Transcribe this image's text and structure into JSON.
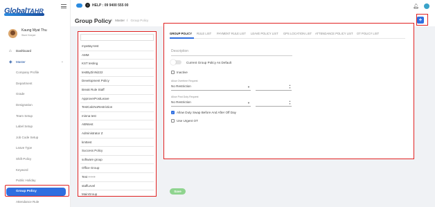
{
  "app": {
    "logo_main": "Global",
    "logo_sub": "TAHR",
    "help": "HELP : 09 9400 555 00"
  },
  "user": {
    "name": "Kaung Myat Thu",
    "role": "Store Keeper"
  },
  "sidebar": {
    "items": [
      {
        "label": "Dashboard"
      },
      {
        "label": "Master"
      },
      {
        "label": "Company Profile"
      },
      {
        "label": "Department"
      },
      {
        "label": "Grade"
      },
      {
        "label": "Designation"
      },
      {
        "label": "Team Setup"
      },
      {
        "label": "Label Setup"
      },
      {
        "label": "Job Code Setup"
      },
      {
        "label": "Leave Type"
      },
      {
        "label": "Shift Policy"
      },
      {
        "label": "Keyword"
      },
      {
        "label": "Public Holiday"
      },
      {
        "label": "Group Policy"
      },
      {
        "label": "Attendance Rule"
      }
    ]
  },
  "page": {
    "title": "Group Policy",
    "breadcrumb": [
      "Master",
      "Group Policy"
    ],
    "add_label": "+"
  },
  "list": {
    "search_placeholder": "",
    "items": [
      "myattay-test",
      "AMM",
      "KST testing",
      "testByZinNi222",
      "Development Policy",
      "Break Rule Staff",
      "ApproverPostLeave",
      "TestCalcNoRestriction",
      "minna test",
      "ABNtest",
      "Administrator Z",
      "kmttest",
      "Success Policy",
      "software group",
      "Office Group",
      "Test ++++",
      "staffLevel",
      "MainGroup"
    ]
  },
  "tabs": [
    {
      "label": "GROUP POLICY",
      "active": true
    },
    {
      "label": "RULE LIST",
      "active": false
    },
    {
      "label": "PAYMENT RULE LIST",
      "active": false
    },
    {
      "label": "LEAVE POLICY LIST",
      "active": false
    },
    {
      "label": "GPS LOCATION LIST",
      "active": false
    },
    {
      "label": "ATTENDANCE POLICY LIST",
      "active": false
    },
    {
      "label": "OT POLICY LIST",
      "active": false
    }
  ],
  "form": {
    "description_placeholder": "Description",
    "default_toggle_label": "Current Group Policy As Default",
    "inactive_label": "Inactive",
    "overtime_request_label": "Allow Overtime Request",
    "overtime_request_value": "No Restriction",
    "post_duty_request_label": "Allow Post Duty Request",
    "post_duty_request_value": "No Restriction",
    "duty_swap_label": "Allow Duty Swap Before And After Off Day",
    "duty_swap_checked": true,
    "urgent_ot_label": "Use Urgent OT",
    "urgent_ot_checked": false,
    "save_label": "Save"
  }
}
